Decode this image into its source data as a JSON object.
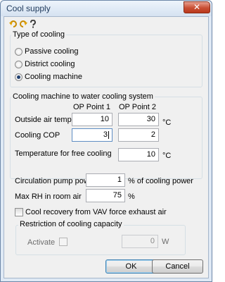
{
  "window": {
    "title": "Cool supply",
    "close_glyph": "✕"
  },
  "toolbar": {
    "icons": [
      "undo-icon",
      "redo-icon",
      "help-icon"
    ]
  },
  "type_of_cooling": {
    "label": "Type of cooling",
    "options": [
      "Passive cooling",
      "District cooling",
      "Cooling machine"
    ],
    "selected": "Cooling machine"
  },
  "cooling_machine": {
    "label": "Cooling machine to water cooling system",
    "op_point_1": "OP Point 1",
    "op_point_2": "OP Point 2",
    "outside_air_temp": {
      "label": "Outside air temp",
      "p1": "10",
      "p2": "30",
      "unit": "°C"
    },
    "cooling_cop": {
      "label": "Cooling COP",
      "p1": "3",
      "p2": "2"
    },
    "free_cooling": {
      "label": "Temperature for free cooling",
      "value": "10",
      "unit": "°C"
    }
  },
  "circulation_pump": {
    "label": "Circulation pump power",
    "value": "1",
    "unit": "% of cooling power"
  },
  "max_rh": {
    "label": "Max RH in room air",
    "value": "75",
    "unit": "%"
  },
  "cool_recovery": {
    "label": "Cool recovery from VAV force exhaust air",
    "checked": false
  },
  "restriction": {
    "label": "Restriction of cooling capacity",
    "activate_label": "Activate",
    "activate_checked": false,
    "value": "0",
    "unit": "W"
  },
  "buttons": {
    "ok": "OK",
    "cancel": "Cancel"
  },
  "colors": {
    "title_text": "#1e395b",
    "close_button": "#c94f34",
    "window_frame": "#dfe9f5",
    "client": "#f0f0f0"
  }
}
